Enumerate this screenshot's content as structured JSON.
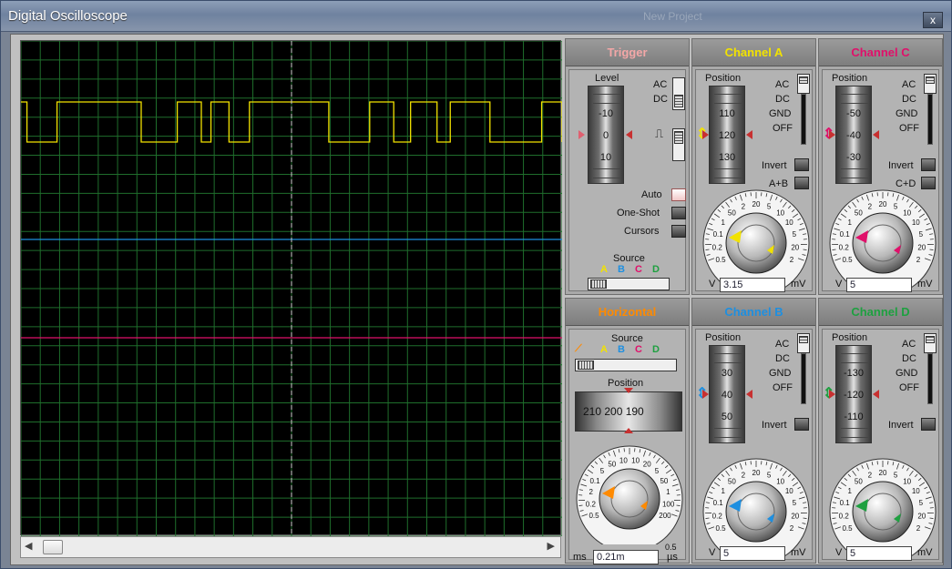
{
  "window": {
    "title": "Digital Oscilloscope",
    "ghost_title": "New Project",
    "close_label": "x"
  },
  "colors": {
    "channel_a": "#f2e200",
    "channel_b": "#1e8fe0",
    "channel_c": "#e0106a",
    "channel_d": "#1ea040",
    "trigger": "#f3a7a7",
    "horizontal": "#ff8a00",
    "grid": "#1f6e2c"
  },
  "trigger": {
    "title": "Trigger",
    "level_label": "Level",
    "drum_values": [
      "-10",
      "0",
      "10"
    ],
    "ac_label": "AC",
    "dc_label": "DC",
    "auto_label": "Auto",
    "oneshot_label": "One-Shot",
    "cursors_label": "Cursors",
    "source_label": "Source",
    "source_a": "A",
    "source_b": "B",
    "source_c": "C",
    "source_d": "D"
  },
  "channel_a": {
    "title": "Channel A",
    "position_label": "Position",
    "drum_values": [
      "110",
      "120",
      "130"
    ],
    "ac_label": "AC",
    "dc_label": "DC",
    "gnd_label": "GND",
    "off_label": "OFF",
    "invert_label": "Invert",
    "combine_label": "A+B",
    "dial_ticks": [
      "0.5",
      "0.2",
      "0.1",
      "1",
      "50",
      "2",
      "20",
      "5",
      "10",
      "10",
      "5",
      "20",
      "2"
    ],
    "unit_left": "V",
    "unit_right": "mV",
    "value": "3.15"
  },
  "channel_c": {
    "title": "Channel C",
    "position_label": "Position",
    "drum_values": [
      "-50",
      "-40",
      "-30"
    ],
    "ac_label": "AC",
    "dc_label": "DC",
    "gnd_label": "GND",
    "off_label": "OFF",
    "invert_label": "Invert",
    "combine_label": "C+D",
    "dial_ticks": [
      "0.5",
      "0.2",
      "0.1",
      "1",
      "50",
      "2",
      "20",
      "5",
      "10",
      "10",
      "5",
      "20",
      "2"
    ],
    "unit_left": "V",
    "unit_right": "mV",
    "value": "5"
  },
  "horizontal": {
    "title": "Horizontal",
    "source_label": "Source",
    "source_a": "A",
    "source_b": "B",
    "source_c": "C",
    "source_d": "D",
    "position_label": "Position",
    "position_scale": "210 200 190",
    "dial_ticks": [
      "0.5",
      "0.2",
      "2",
      "0.1",
      "5",
      "50",
      "10",
      "10",
      "20",
      "5",
      "50",
      "1",
      "100",
      "200"
    ],
    "unit_left": "ms",
    "unit_right": "µs",
    "right_bottom_tick": "0.5",
    "value": "0.21m"
  },
  "channel_b": {
    "title": "Channel B",
    "position_label": "Position",
    "drum_values": [
      "30",
      "40",
      "50"
    ],
    "ac_label": "AC",
    "dc_label": "DC",
    "gnd_label": "GND",
    "off_label": "OFF",
    "invert_label": "Invert",
    "dial_ticks": [
      "0.5",
      "0.2",
      "0.1",
      "1",
      "50",
      "2",
      "20",
      "5",
      "10",
      "10",
      "5",
      "20",
      "2"
    ],
    "unit_left": "V",
    "unit_right": "mV",
    "value": "5"
  },
  "channel_d": {
    "title": "Channel D",
    "position_label": "Position",
    "drum_values": [
      "-130",
      "-120",
      "-110"
    ],
    "ac_label": "AC",
    "dc_label": "DC",
    "gnd_label": "GND",
    "off_label": "OFF",
    "invert_label": "Invert",
    "dial_ticks": [
      "0.5",
      "0.2",
      "0.1",
      "1",
      "50",
      "2",
      "20",
      "5",
      "10",
      "10",
      "5",
      "20",
      "2"
    ],
    "unit_left": "V",
    "unit_right": "mV",
    "value": "5"
  },
  "scope": {
    "trace_a_transitions": [
      0,
      0.5,
      3,
      10,
      13,
      15,
      15.8,
      17.3,
      19,
      25.6,
      29,
      31,
      32.4,
      34.6,
      35.7,
      39,
      43.3,
      45
    ]
  }
}
